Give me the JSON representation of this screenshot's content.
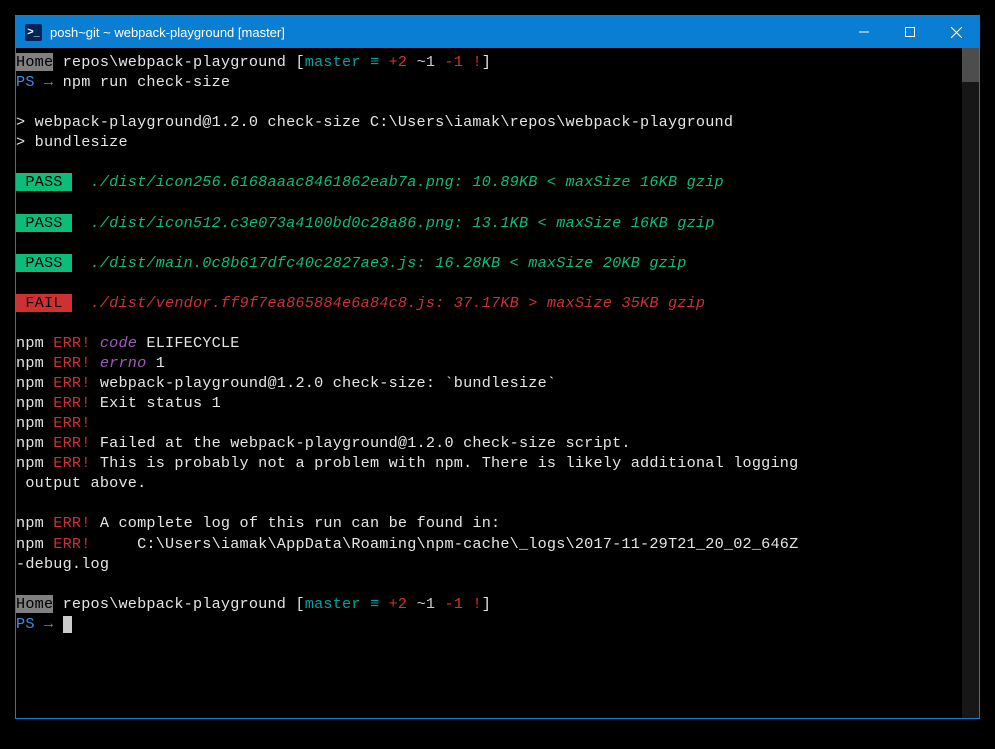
{
  "titlebar": {
    "icon_glyph": ">_",
    "title": "posh~git ~ webpack-playground [master]"
  },
  "prompt": {
    "home": "Home",
    "path": " repos\\webpack-playground ",
    "lbracket": "[",
    "branch": "master",
    "equiv": " ≡ ",
    "plus": "+2 ",
    "tilde": "~1 ",
    "minus": "-1 ",
    "excl": "!",
    "rbracket": "]",
    "ps": "PS",
    "arrow": " → "
  },
  "cmd1": "npm run check-size",
  "script_header": {
    "l1": "> webpack-playground@1.2.0 check-size C:\\Users\\iamak\\repos\\webpack-playground",
    "l2": "> bundlesize"
  },
  "results": [
    {
      "badge": " PASS ",
      "type": "pass",
      "text": "  ./dist/icon256.6168aaac8461862eab7a.png: 10.89KB < maxSize 16KB gzip"
    },
    {
      "badge": " PASS ",
      "type": "pass",
      "text": "  ./dist/icon512.c3e073a4100bd0c28a86.png: 13.1KB < maxSize 16KB gzip"
    },
    {
      "badge": " PASS ",
      "type": "pass",
      "text": "  ./dist/main.0c8b617dfc40c2827ae3.js: 16.28KB < maxSize 20KB gzip"
    },
    {
      "badge": " FAIL ",
      "type": "fail",
      "text": "  ./dist/vendor.ff9f7ea865884e6a84c8.js: 37.17KB > maxSize 35KB gzip"
    }
  ],
  "npm": "npm",
  "err": " ERR!",
  "errs": {
    "code_k": " code",
    "code_v": " ELIFECYCLE",
    "errno_k": " errno",
    "errno_v": " 1",
    "e3": " webpack-playground@1.2.0 check-size: `bundlesize`",
    "e4": " Exit status 1",
    "e6": " Failed at the webpack-playground@1.2.0 check-size script.",
    "e7": " This is probably not a problem with npm. There is likely additional logging",
    "e7b": " output above.",
    "e8": " A complete log of this run can be found in:",
    "e9": "     C:\\Users\\iamak\\AppData\\Roaming\\npm-cache\\_logs\\2017-11-29T21_20_02_646Z",
    "e9b": "-debug.log"
  }
}
